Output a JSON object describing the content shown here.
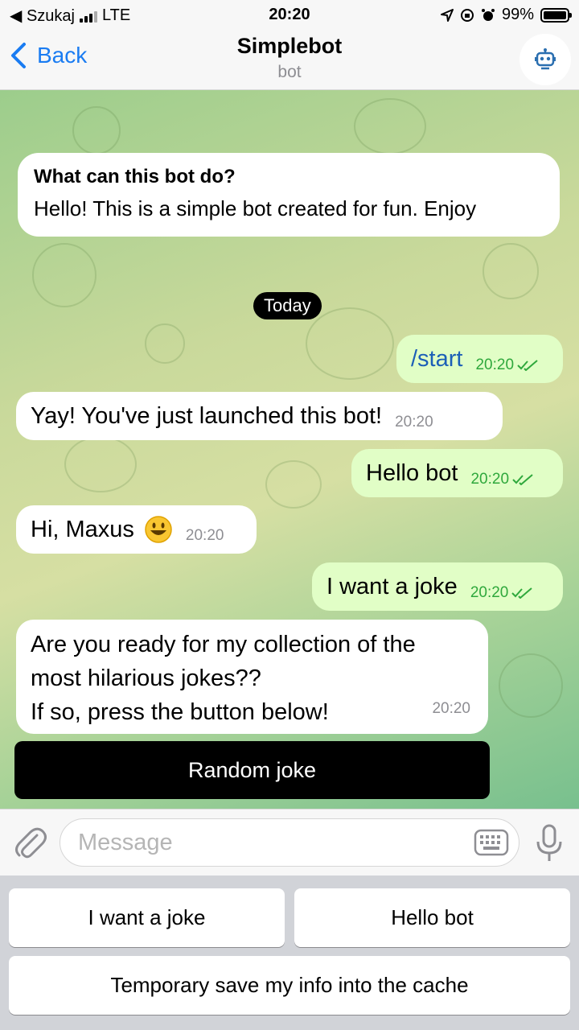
{
  "status_bar": {
    "back_label": "◀ Szukaj",
    "network": "LTE",
    "time": "20:20",
    "battery": "99%",
    "battery_level": 0.99
  },
  "header": {
    "back_label": "Back",
    "title": "Simplebot",
    "subtitle": "bot",
    "avatar_icon": "robot-icon"
  },
  "info_card": {
    "title": "What can this bot do?",
    "text": "Hello!  This is a simple bot created for fun. Enjoy"
  },
  "date_chip": "Today",
  "messages": [
    {
      "direction": "out",
      "text": "/start",
      "time": "20:20",
      "read": true
    },
    {
      "direction": "in",
      "text": "Yay! You've just launched this bot!",
      "time": "20:20"
    },
    {
      "direction": "out",
      "text": "Hello bot",
      "time": "20:20",
      "read": true
    },
    {
      "direction": "in",
      "text": "Hi, Maxus",
      "emoji": "smiley",
      "time": "20:20"
    },
    {
      "direction": "out",
      "text": "I want a joke",
      "time": "20:20",
      "read": true
    },
    {
      "direction": "in",
      "lines": [
        "Are you ready for my collection of the",
        "most hilarious jokes??",
        "If so, press the button below!"
      ],
      "time": "20:20"
    }
  ],
  "inline_button": "Random joke",
  "input": {
    "placeholder": "Message",
    "value": "",
    "attach_icon": "paperclip-icon",
    "keyboard_icon": "keyboard-icon",
    "mic_icon": "microphone-icon"
  },
  "reply_keyboard": [
    "I want a joke",
    "Hello bot",
    "Temporary save my info into the cache"
  ],
  "colors": {
    "accent": "#1a7cf2",
    "outgoing_bubble": "#e1fec6",
    "outgoing_time": "#2fa83c",
    "incoming_bubble": "#ffffff"
  }
}
